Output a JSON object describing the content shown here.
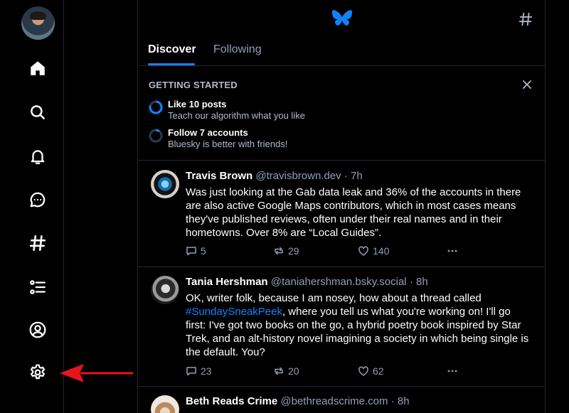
{
  "nav": {
    "items": [
      {
        "icon": "home-icon"
      },
      {
        "icon": "search-icon"
      },
      {
        "icon": "bell-icon"
      },
      {
        "icon": "chat-icon"
      },
      {
        "icon": "hashtag-icon"
      },
      {
        "icon": "list-icon"
      },
      {
        "icon": "profile-icon"
      },
      {
        "icon": "gear-icon"
      }
    ]
  },
  "header": {
    "tabs": [
      {
        "label": "Discover",
        "active": true
      },
      {
        "label": "Following",
        "active": false
      }
    ]
  },
  "getting_started": {
    "title": "GETTING STARTED",
    "tasks": [
      {
        "title": "Like 10 posts",
        "subtitle": "Teach our algorithm what you like"
      },
      {
        "title": "Follow 7 accounts",
        "subtitle": "Bluesky is better with friends!"
      }
    ]
  },
  "posts": [
    {
      "name": "Travis Brown",
      "handle": "@travisbrown.dev",
      "time": "· 7h",
      "text": "Was just looking at the Gab data leak and 36% of the accounts in there are also active Google Maps contributors, which in most cases means they've published reviews, often under their real names and in their hometowns. Over 8% are “Local Guides”.",
      "replies": "5",
      "reposts": "29",
      "likes": "140"
    },
    {
      "name": "Tania Hershman",
      "handle": "@taniahershman.bsky.social",
      "time": "· 8h",
      "text_before": "OK, writer folk, because I am nosey, how about a thread called ",
      "hashtag": "#SundaySneakPeek",
      "text_after": ", where you tell us what you're working on! I'll go first: I've got two books on the go, a hybrid poetry book inspired by Star Trek, and an alt-history novel imagining a society in which being single is the default. You?",
      "replies": "23",
      "reposts": "20",
      "likes": "62"
    },
    {
      "name": "Beth Reads Crime",
      "handle": "@bethreadscrime.com",
      "time": "· 8h"
    }
  ],
  "colors": {
    "accent": "#1083fe",
    "annotation_arrow": "#e8141c"
  }
}
